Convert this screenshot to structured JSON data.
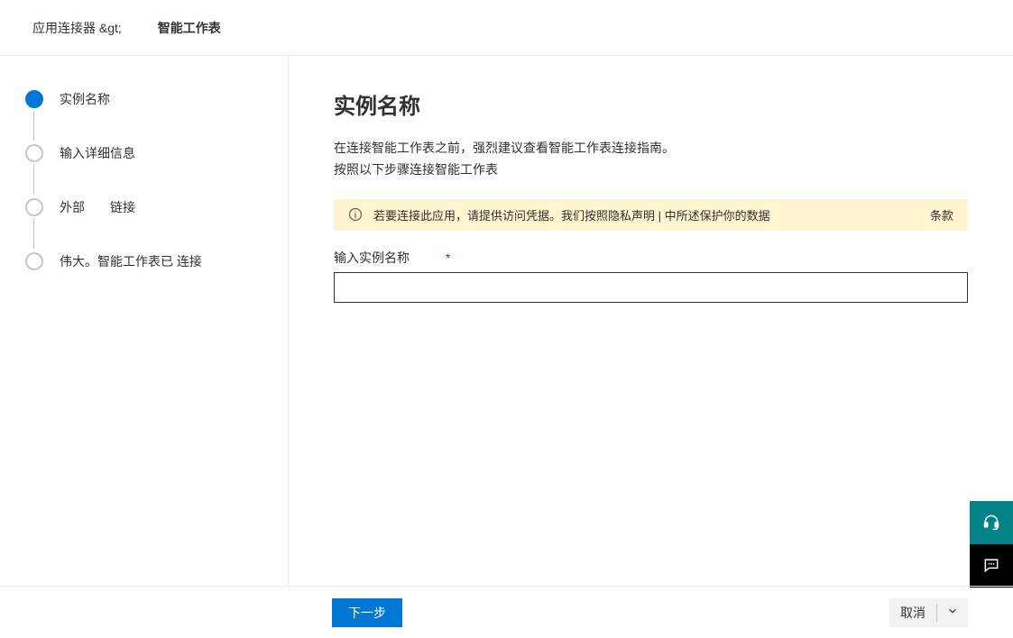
{
  "breadcrumb": {
    "prev": "应用连接器 &gt;",
    "current": "智能工作表"
  },
  "steps": [
    {
      "label": "实例名称",
      "active": true
    },
    {
      "label": "输入详细信息",
      "active": false
    },
    {
      "label": "外部　　链接",
      "active": false
    },
    {
      "label": "伟大。智能工作表已 连接",
      "active": false
    }
  ],
  "main": {
    "title": "实例名称",
    "intro_line1": "在连接智能工作表之前，强烈建议查看智能工作表连接指南。",
    "intro_line2": "按照以下步骤连接智能工作表"
  },
  "info_bar": {
    "message": "若要连接此应用，请提供访问凭据。我们按照隐私声明 | 中所述保护你的数据",
    "terms": "条款"
  },
  "form": {
    "instance_label": "输入实例名称",
    "instance_value": ""
  },
  "footer": {
    "next": "下一步",
    "cancel": "取消"
  }
}
